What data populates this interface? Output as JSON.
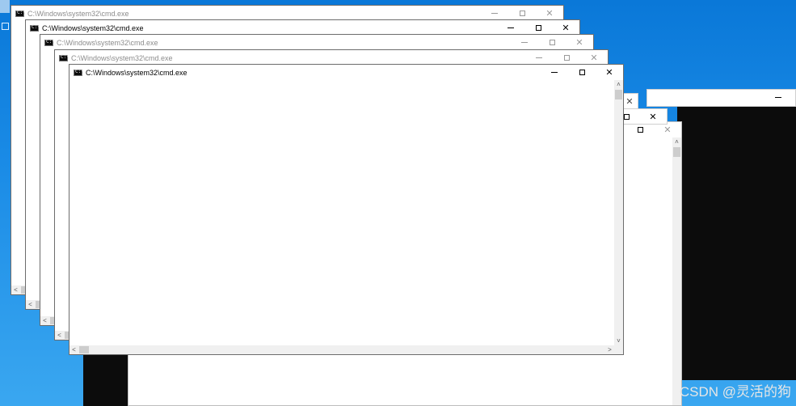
{
  "windows": [
    {
      "title": "C:\\Windows\\system32\\cmd.exe",
      "state": "inactive"
    },
    {
      "title": "C:\\Windows\\system32\\cmd.exe",
      "state": "active"
    },
    {
      "title": "C:\\Windows\\system32\\cmd.exe",
      "state": "inactive"
    },
    {
      "title": "C:\\Windows\\system32\\cmd.exe",
      "state": "inactive"
    },
    {
      "title": "C:\\Windows\\system32\\cmd.exe",
      "state": "active"
    }
  ],
  "controls": {
    "minimize": "–",
    "maximize": "□",
    "close": "✕"
  },
  "scroll_glyphs": {
    "up": "˄",
    "down": "˅",
    "left": "<",
    "right": ">"
  },
  "watermark": "CSDN @灵活的狗",
  "colors": {
    "desktop": "#0a78d8",
    "console_bg": "#0c0c0c",
    "window_bg": "#ffffff"
  }
}
